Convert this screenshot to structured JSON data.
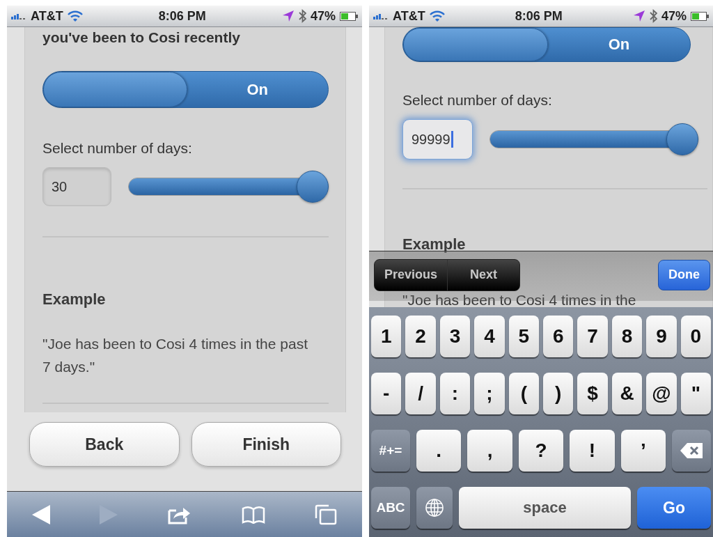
{
  "screens": [
    {
      "kind": "form",
      "status_bar": {
        "carrier": "AT&T",
        "time": "8:06 PM",
        "battery": "47%"
      },
      "heading": "you've been to Cosi recently",
      "toggle": {
        "label": "On",
        "on": true
      },
      "days_label": "Select number of days:",
      "days_field": {
        "value": "30",
        "focused": false
      },
      "slider": {
        "level": 1
      },
      "example": {
        "title": "Example",
        "text": "\"Joe has been to Cosi 4 times in the past 7 days.\""
      },
      "buttons": [
        {
          "label": "Back"
        },
        {
          "label": "Finish"
        }
      ]
    },
    {
      "kind": "keyboard",
      "status_bar": {
        "carrier": "AT&T",
        "time": "8:06 PM",
        "battery": "47%"
      },
      "toggle": {
        "label": "On",
        "on": true
      },
      "days_label": "Select number of days:",
      "days_field": {
        "value": "99999",
        "focused": true
      },
      "slider": {
        "level": 1
      },
      "example": {
        "title": "Example",
        "text": "\"Joe has been to Cosi 4 times in the"
      },
      "accessory": {
        "previous": "Previous",
        "next": "Next",
        "done": "Done"
      },
      "keyboard": [
        [
          {
            "kind": "char",
            "label": "1"
          },
          {
            "kind": "char",
            "label": "2"
          },
          {
            "kind": "char",
            "label": "3"
          },
          {
            "kind": "char",
            "label": "4"
          },
          {
            "kind": "char",
            "label": "5"
          },
          {
            "kind": "char",
            "label": "6"
          },
          {
            "kind": "char",
            "label": "7"
          },
          {
            "kind": "char",
            "label": "8"
          },
          {
            "kind": "char",
            "label": "9"
          },
          {
            "kind": "char",
            "label": "0"
          }
        ],
        [
          {
            "kind": "char",
            "label": "-"
          },
          {
            "kind": "char",
            "label": "/"
          },
          {
            "kind": "char",
            "label": ":"
          },
          {
            "kind": "char",
            "label": ";"
          },
          {
            "kind": "char",
            "label": "("
          },
          {
            "kind": "char",
            "label": ")"
          },
          {
            "kind": "char",
            "label": "$"
          },
          {
            "kind": "char",
            "label": "&"
          },
          {
            "kind": "char",
            "label": "@"
          },
          {
            "kind": "char",
            "label": "\""
          }
        ],
        [
          {
            "kind": "mod",
            "label": "#+="
          },
          {
            "kind": "char",
            "label": "."
          },
          {
            "kind": "char",
            "label": ","
          },
          {
            "kind": "char",
            "label": "?"
          },
          {
            "kind": "char",
            "label": "!"
          },
          {
            "kind": "char",
            "label": "’"
          },
          {
            "kind": "backspace"
          }
        ],
        [
          {
            "kind": "mod",
            "label": "ABC"
          },
          {
            "kind": "globe"
          },
          {
            "kind": "space",
            "label": "space"
          },
          {
            "kind": "go",
            "label": "Go"
          }
        ]
      ]
    }
  ]
}
